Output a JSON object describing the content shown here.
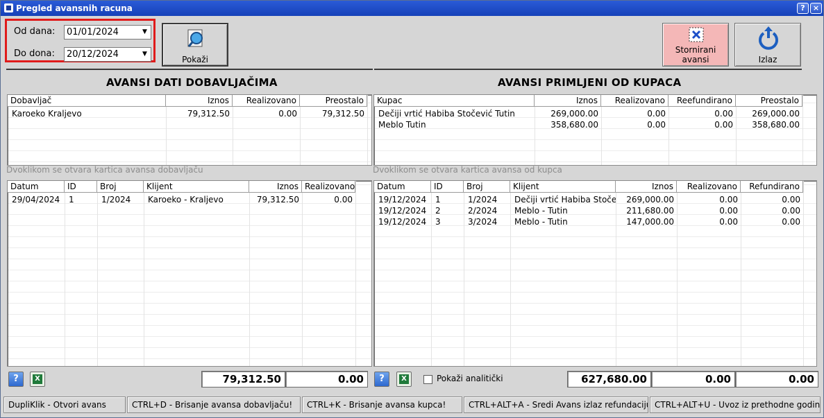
{
  "window": {
    "title": "Pregled avansnih racuna",
    "help_glyph": "?",
    "close_glyph": "×"
  },
  "filters": {
    "from_label": "Od dana:",
    "from_value": "01/01/2024",
    "to_label": "Do dona:",
    "to_value": "20/12/2024"
  },
  "toolbar": {
    "show_label": "Pokaži",
    "storno_line1": "Stornirani",
    "storno_line2": "avansi",
    "exit_label": "Izlaz"
  },
  "left": {
    "title": "AVANSI DATI DOBAVLJAČIMA",
    "summary_headers": [
      "Dobavljač",
      "Iznos",
      "Realizovano",
      "Preostalo"
    ],
    "summary_rows": [
      [
        "Karoeko Kraljevo",
        "79,312.50",
        "0.00",
        "79,312.50"
      ]
    ],
    "hint": "Dvoklikom se otvara kartica avansa dobavljaču",
    "detail_headers": [
      "Datum",
      "ID",
      "Broj",
      "Klijent",
      "Iznos",
      "Realizovano"
    ],
    "detail_rows": [
      [
        "29/04/2024",
        "1",
        "1/2024",
        "Karoeko - Kraljevo",
        "79,312.50",
        "0.00"
      ]
    ],
    "totals": [
      "79,312.50",
      "0.00"
    ]
  },
  "right": {
    "title": "AVANSI PRIMLJENI OD KUPACA",
    "summary_headers": [
      "Kupac",
      "Iznos",
      "Realizovano",
      "Reefundirano",
      "Preostalo"
    ],
    "summary_rows": [
      [
        "Dečiji vrtić Habiba Stočević Tutin",
        "269,000.00",
        "0.00",
        "0.00",
        "269,000.00"
      ],
      [
        "Meblo Tutin",
        "358,680.00",
        "0.00",
        "0.00",
        "358,680.00"
      ]
    ],
    "hint": "Dvoklikom se otvara kartica avansa od kupca",
    "detail_headers": [
      "Datum",
      "ID",
      "Broj",
      "Klijent",
      "Iznos",
      "Realizovano",
      "Refundirano"
    ],
    "detail_rows": [
      [
        "19/12/2024",
        "1",
        "1/2024",
        "Dečiji vrtić Habiba Stoče...",
        "269,000.00",
        "0.00",
        "0.00"
      ],
      [
        "19/12/2024",
        "2",
        "2/2024",
        "Meblo - Tutin",
        "211,680.00",
        "0.00",
        "0.00"
      ],
      [
        "19/12/2024",
        "3",
        "3/2024",
        "Meblo - Tutin",
        "147,000.00",
        "0.00",
        "0.00"
      ]
    ],
    "analytic_label": "Pokaži analitički",
    "totals": [
      "627,680.00",
      "0.00",
      "0.00"
    ]
  },
  "status": [
    "DupliKlik - Otvori avans",
    "CTRL+D - Brisanje avansa dobavljaču!",
    "CTRL+K - Brisanje avansa kupca!",
    "CTRL+ALT+A - Sredi Avans izlaz refundaciju",
    "CTRL+ALT+U - Uvoz iz prethodne godine"
  ],
  "icons": {
    "help": "?",
    "excel": "X"
  },
  "colors": {
    "titlebar": "#1f4fc8",
    "highlight": "#e01b1b",
    "storno_bg": "#f4b7b7"
  }
}
